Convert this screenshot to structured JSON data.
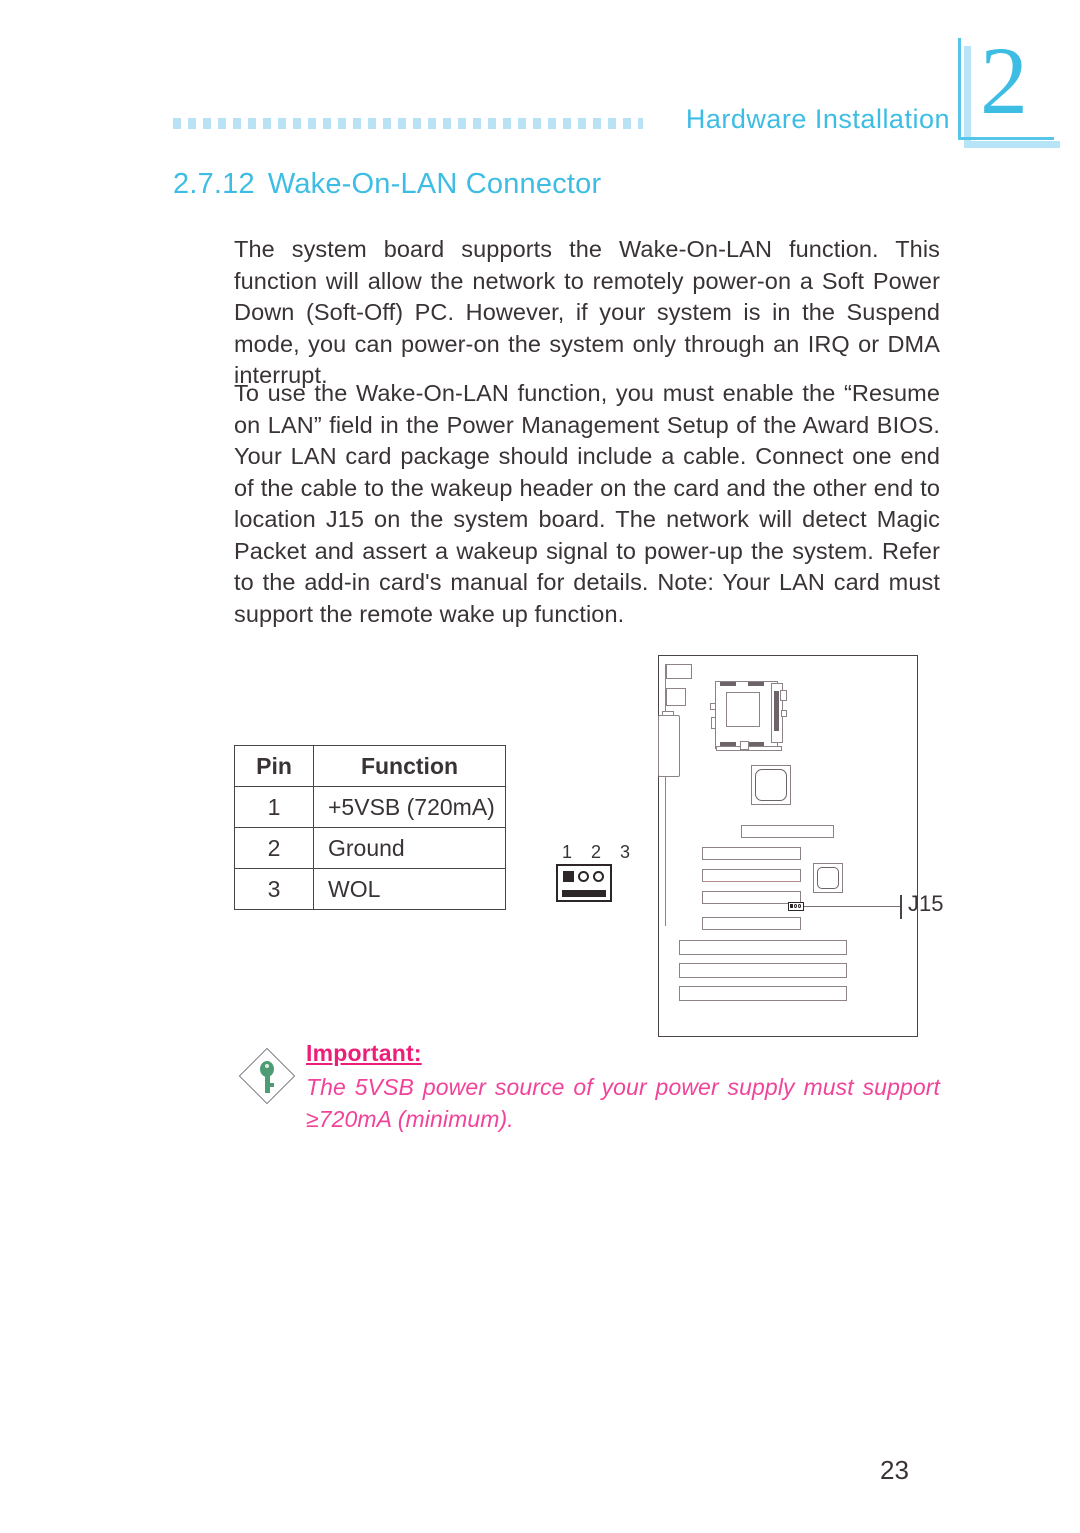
{
  "header": {
    "title": "Hardware Installation",
    "chapter_number": "2",
    "accent_color": "#3dbde3",
    "dot_rule_color": "#b9e2f5"
  },
  "section": {
    "number": "2.7.12",
    "title": "Wake-On-LAN Connector"
  },
  "paragraphs": [
    "The system board supports the Wake-On-LAN function. This function will allow the network to remotely power-on a Soft Power Down (Soft-Off) PC. However, if your system is in the Suspend mode, you can power-on the system only through an IRQ or DMA interrupt.",
    "To use the Wake-On-LAN function, you must enable the “Resume on LAN” field in the Power Management Setup of the  Award BIOS. Your LAN card package should include a cable. Connect one end of the cable to the wakeup header on the card and the other end to location J15 on the system board. The network will detect Magic Packet and assert a wakeup signal to power-up the system. Refer to the add-in card's manual for details. Note: Your LAN card must support the remote wake up function."
  ],
  "pin_table": {
    "headers": [
      "Pin",
      "Function"
    ],
    "rows": [
      {
        "pin": "1",
        "function": "+5VSB  (720mA)"
      },
      {
        "pin": "2",
        "function": "Ground"
      },
      {
        "pin": "3",
        "function": "WOL"
      }
    ]
  },
  "connector_figure": {
    "pin_labels": "1 2 3"
  },
  "board_figure": {
    "callout_label": "J15"
  },
  "important_note": {
    "title": "Important:",
    "text": "The 5VSB power source of your power supply must support ≥720mA (minimum).",
    "title_color": "#ed1e79",
    "text_color": "#f0449a",
    "icon": "key-icon"
  },
  "page_number": "23"
}
